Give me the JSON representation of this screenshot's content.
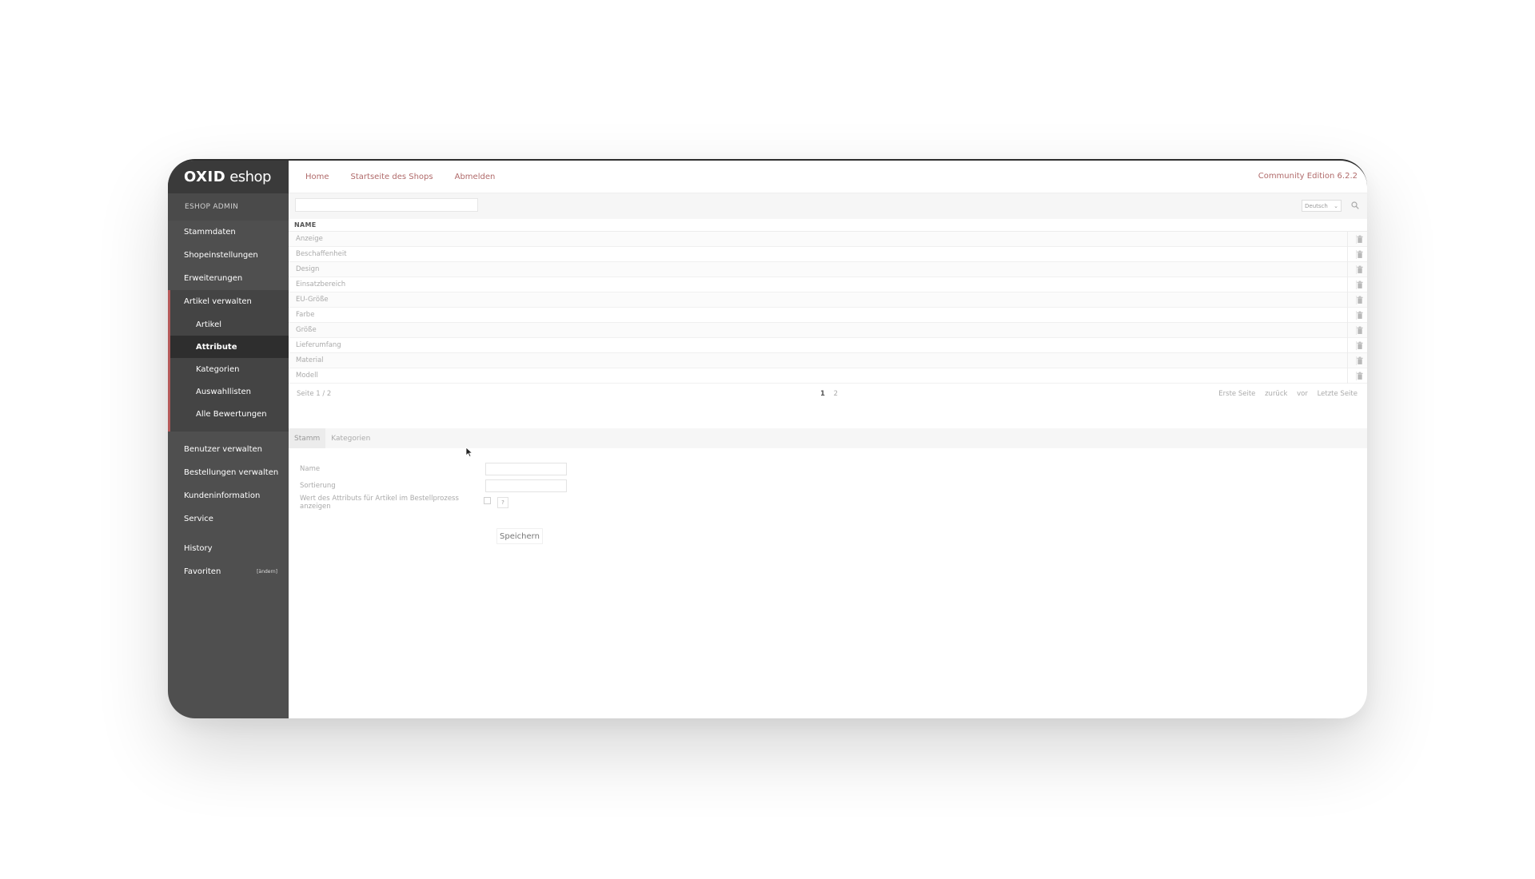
{
  "logo": {
    "part1": "OXID",
    "part2": "eshop"
  },
  "sidebar": {
    "admin_label": "ESHOP ADMIN",
    "items_top": [
      {
        "label": "Stammdaten"
      },
      {
        "label": "Shopeinstellungen"
      },
      {
        "label": "Erweiterungen"
      }
    ],
    "group": {
      "label": "Artikel verwalten",
      "subitems": [
        {
          "label": "Artikel"
        },
        {
          "label": "Attribute"
        },
        {
          "label": "Kategorien"
        },
        {
          "label": "Auswahllisten"
        },
        {
          "label": "Alle Bewertungen"
        }
      ]
    },
    "items_bottom": [
      {
        "label": "Benutzer verwalten"
      },
      {
        "label": "Bestellungen verwalten"
      },
      {
        "label": "Kundeninformation"
      },
      {
        "label": "Service"
      }
    ],
    "history": "History",
    "favorites": "Favoriten",
    "favorites_edit": "[ändern]"
  },
  "topbar": {
    "links": [
      "Home",
      "Startseite des Shops",
      "Abmelden"
    ],
    "edition": "Community Edition 6.2.2"
  },
  "filter": {
    "language": "Deutsch"
  },
  "list": {
    "column": "NAME",
    "rows": [
      "Anzeige",
      "Beschaffenheit",
      "Design",
      "Einsatzbereich",
      "EU-Größe",
      "Farbe",
      "Größe",
      "Lieferumfang",
      "Material",
      "Modell"
    ]
  },
  "pager": {
    "page_info": "Seite 1 / 2",
    "current": "1",
    "other": "2",
    "first": "Erste Seite",
    "prev": "zurück",
    "next": "vor",
    "last": "Letzte Seite"
  },
  "tabs": [
    "Stamm",
    "Kategorien"
  ],
  "form": {
    "name_label": "Name",
    "sort_label": "Sortierung",
    "display_label": "Wert des Attributs für Artikel im Bestellprozess anzeigen",
    "help": "?",
    "save": "Speichern"
  },
  "colors": {
    "accent": "#b06a6a",
    "sidebar": "#4f4f4f",
    "sidebar_dark": "#3a3a3a",
    "active": "#2e2e2e"
  }
}
